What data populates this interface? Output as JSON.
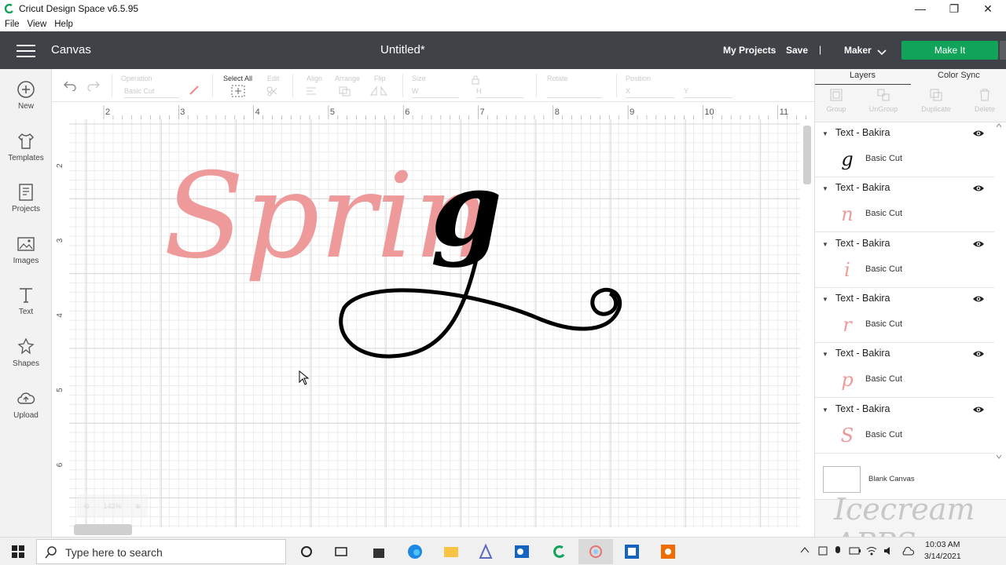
{
  "window": {
    "title": "Cricut Design Space  v6.5.95",
    "controls": [
      "minimize",
      "restore",
      "close"
    ]
  },
  "menu": [
    "File",
    "View",
    "Help"
  ],
  "header": {
    "canvas_label": "Canvas",
    "doc_title": "Untitled*",
    "my_projects": "My Projects",
    "save": "Save",
    "separator": "|",
    "machine": "Maker",
    "make_it": "Make It",
    "accent": "#12a35b",
    "bg": "#3f4347"
  },
  "sidebar": [
    {
      "label": "New",
      "icon": "plus-circle-icon"
    },
    {
      "label": "Templates",
      "icon": "tshirt-icon"
    },
    {
      "label": "Projects",
      "icon": "projects-icon"
    },
    {
      "label": "Images",
      "icon": "image-icon"
    },
    {
      "label": "Text",
      "icon": "text-icon"
    },
    {
      "label": "Shapes",
      "icon": "shapes-icon"
    },
    {
      "label": "Upload",
      "icon": "upload-cloud-icon"
    }
  ],
  "toolbar": {
    "operation_label": "Operation",
    "operation_value": "Basic Cut",
    "select_all": "Select All",
    "edit": "Edit",
    "align": "Align",
    "arrange": "Arrange",
    "flip": "Flip",
    "size": "Size",
    "w": "W",
    "h": "H",
    "rotate": "Rotate",
    "position": "Position",
    "x": "X",
    "y": "Y"
  },
  "ruler": {
    "h_ticks": [
      "2",
      "3",
      "4",
      "5",
      "6",
      "7",
      "8",
      "9",
      "10",
      "11"
    ],
    "v_ticks": [
      "2",
      "3",
      "4",
      "5",
      "6"
    ]
  },
  "canvas": {
    "text_pink": "Sprin",
    "text_black": "g",
    "pink": "#ef9a9a",
    "black": "#000000",
    "zoom": "143%"
  },
  "panel": {
    "tabs": [
      "Layers",
      "Color Sync"
    ],
    "actions": [
      "Group",
      "UnGroup",
      "Duplicate",
      "Delete"
    ],
    "layers": [
      {
        "name": "Text - Bakira",
        "op": "Basic Cut",
        "glyph": "g",
        "color": "#111111"
      },
      {
        "name": "Text - Bakira",
        "op": "Basic Cut",
        "glyph": "n",
        "color": "#ef9a9a"
      },
      {
        "name": "Text - Bakira",
        "op": "Basic Cut",
        "glyph": "i",
        "color": "#ef9a9a"
      },
      {
        "name": "Text - Bakira",
        "op": "Basic Cut",
        "glyph": "r",
        "color": "#ef9a9a"
      },
      {
        "name": "Text - Bakira",
        "op": "Basic Cut",
        "glyph": "p",
        "color": "#ef9a9a"
      },
      {
        "name": "Text - Bakira",
        "op": "Basic Cut",
        "glyph": "S",
        "color": "#ef9a9a"
      }
    ],
    "blank_canvas": "Blank Canvas",
    "watermark": "Icecream APPS"
  },
  "taskbar": {
    "search_placeholder": "Type here to search",
    "time": "10:03 AM",
    "date": "3/14/2021"
  }
}
